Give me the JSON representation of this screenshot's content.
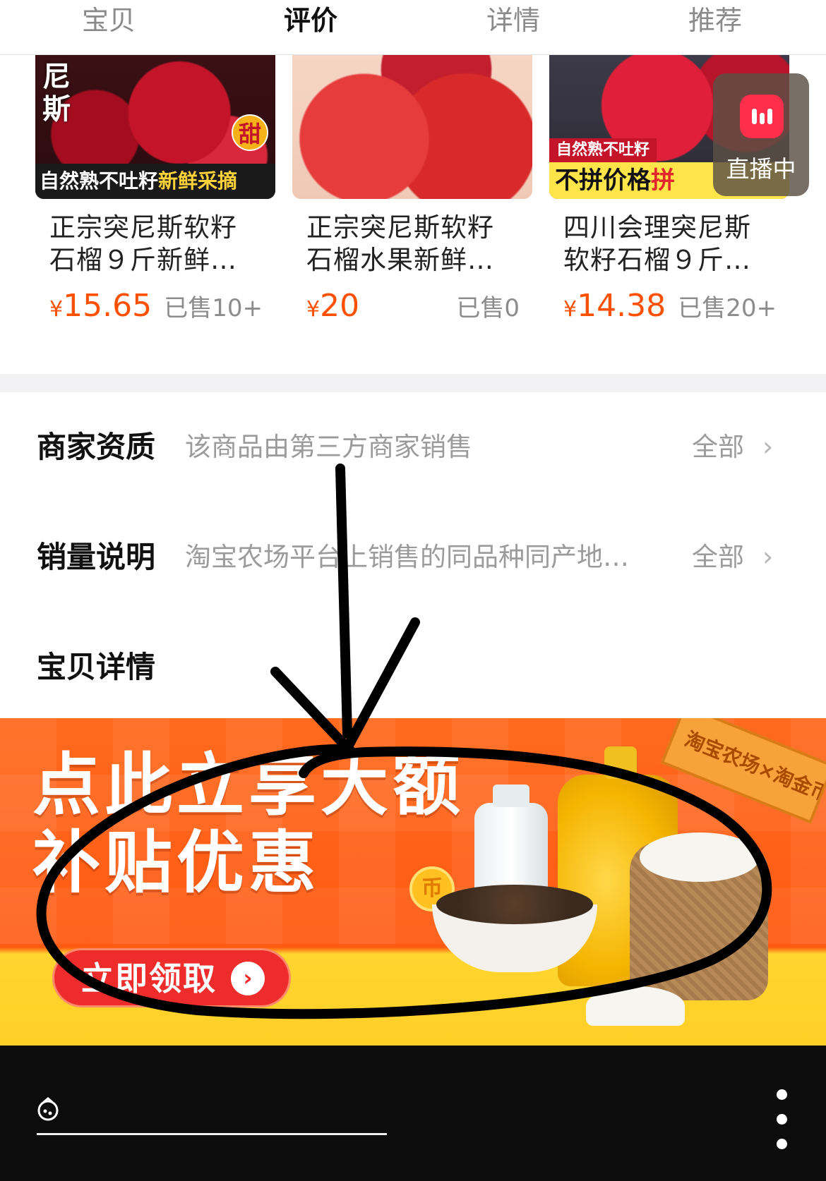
{
  "tabs": [
    {
      "label": "宝贝",
      "active": false
    },
    {
      "label": "评价",
      "active": true
    },
    {
      "label": "详情",
      "active": false
    },
    {
      "label": "推荐",
      "active": false
    }
  ],
  "products": [
    {
      "image_text_side": "尼斯",
      "image_badge": "甜",
      "image_banner_plain": "自然熟不吐籽",
      "image_banner_highlight": "新鲜采摘",
      "name": "正宗突尼斯软籽石榴９斤新鲜…",
      "price_symbol": "¥",
      "price_value": "15.65",
      "sold": "已售10+"
    },
    {
      "name": "正宗突尼斯软籽石榴水果新鲜…",
      "price_symbol": "¥",
      "price_value": "20",
      "sold": "已售0"
    },
    {
      "image_tag": "自然熟不吐籽",
      "image_banner_plain": "不拼价格",
      "image_banner_highlight": "拼",
      "name": "四川会理突尼斯软籽石榴９斤…",
      "price_symbol": "¥",
      "price_value": "14.38",
      "sold": "已售20+"
    }
  ],
  "live": {
    "label": "直播中",
    "icon": "live-bars-icon",
    "color": "#ff2e4a"
  },
  "info_rows": [
    {
      "title": "商家资质",
      "desc": "该商品由第三方商家销售",
      "more": "全部"
    },
    {
      "title": "销量说明",
      "desc": "淘宝农场平台上销售的同品种同产地…",
      "more": "全部"
    }
  ],
  "detail_title": "宝贝详情",
  "promo": {
    "line1": "点此立享大额",
    "line2": "补贴优惠",
    "cta": "立即领取",
    "coin": "币",
    "sign": "淘宝农场×淘金币"
  },
  "colors": {
    "price": "#ff5000",
    "promo_bg": "#ff5a12",
    "cta_bg": "#ef2c2c"
  }
}
